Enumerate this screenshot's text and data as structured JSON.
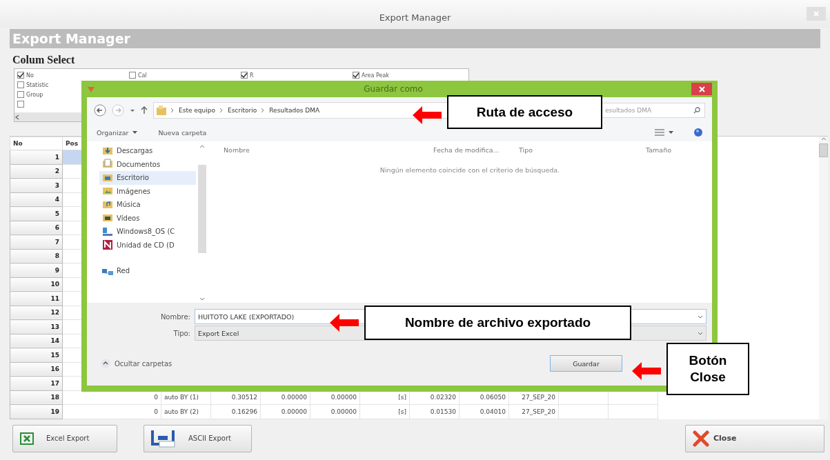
{
  "window": {
    "title": "Export Manager"
  },
  "header": {
    "title": "Export Manager"
  },
  "column_select": {
    "title": "Colum Select",
    "options": [
      {
        "label": "No",
        "checked": true
      },
      {
        "label": "Cal",
        "checked": false
      },
      {
        "label": "R",
        "checked": true
      },
      {
        "label": "Area Peak",
        "checked": true
      },
      {
        "label": "Statistic",
        "checked": false
      },
      {
        "label": "Group",
        "checked": false
      },
      {
        "checked": false
      }
    ]
  },
  "table": {
    "columns": [
      "No",
      "Pos"
    ],
    "rows": [
      {
        "number": "1",
        "selected": true
      },
      {
        "number": "2",
        "selected": false
      },
      {
        "number": "3",
        "selected": false
      },
      {
        "number": "4",
        "selected": false
      },
      {
        "number": "5",
        "selected": false
      },
      {
        "number": "6",
        "selected": false
      },
      {
        "number": "7",
        "selected": false
      },
      {
        "number": "8",
        "selected": false
      },
      {
        "number": "9",
        "selected": false
      },
      {
        "number": "10",
        "selected": false
      },
      {
        "number": "11",
        "selected": false
      },
      {
        "number": "12",
        "selected": false
      },
      {
        "number": "13",
        "selected": false
      },
      {
        "number": "14",
        "selected": false
      },
      {
        "number": "15",
        "selected": false
      },
      {
        "number": "16",
        "selected": false
      },
      {
        "number": "17",
        "selected": false
      },
      {
        "number": "18",
        "selected": false,
        "cells": [
          "0",
          "auto BY (1)",
          "0.30512",
          "0.00000",
          "0.00000",
          "[s]",
          "0.02320",
          "0.06050",
          "27_SEP_20"
        ]
      },
      {
        "number": "19",
        "selected": false,
        "cells": [
          "0",
          "auto BY (2)",
          "0.16296",
          "0.00000",
          "0.00000",
          "[s]",
          "0.01530",
          "0.04010",
          "27_SEP_20"
        ]
      }
    ]
  },
  "buttons": [
    {
      "kind": "excel",
      "label": "Excel Export"
    },
    {
      "kind": "ascii",
      "label": "ASCII Export"
    },
    {
      "kind": "close",
      "label": "Close"
    }
  ],
  "dialog": {
    "title": "Guardar como",
    "path": [
      "Este equipo",
      "Escritorio",
      "Resultados DMA"
    ],
    "search": {
      "placeholder": "esultados DMA"
    },
    "toolbar": [
      {
        "label": "Organizar",
        "kind": "menu"
      },
      {
        "label": "Nueva carpeta",
        "kind": "plain"
      }
    ],
    "nav": [
      {
        "label": "Descargas",
        "kind": "download",
        "selected": false
      },
      {
        "label": "Documentos",
        "kind": "documents",
        "selected": false
      },
      {
        "label": "Escritorio",
        "kind": "desktop",
        "selected": true
      },
      {
        "label": "Imágenes",
        "kind": "images",
        "selected": false
      },
      {
        "label": "Música",
        "kind": "music",
        "selected": false
      },
      {
        "label": "Vídeos",
        "kind": "videos",
        "selected": false
      },
      {
        "label": "Windows8_OS (C",
        "kind": "drive",
        "selected": false
      },
      {
        "label": "Unidad de CD (D",
        "kind": "cd",
        "selected": false
      }
    ],
    "network": {
      "label": "Red"
    },
    "columns": [
      "Nombre",
      "Fecha de modifica...",
      "Tipo",
      "Tamaño"
    ],
    "empty_message": "Ningún elemento coincide con el criterio de búsqueda.",
    "file_name": {
      "label": "Nombre:",
      "value": "HUITOTO LAKE (EXPORTADO)"
    },
    "file_type": {
      "label": "Tipo:",
      "value": "Export Excel"
    },
    "hide_folders": "Ocultar carpetas",
    "save_button": "Guardar"
  },
  "callouts": [
    {
      "text": "Ruta de acceso"
    },
    {
      "text": "Nombre de archivo exportado"
    },
    {
      "text": "Botón Close"
    }
  ]
}
